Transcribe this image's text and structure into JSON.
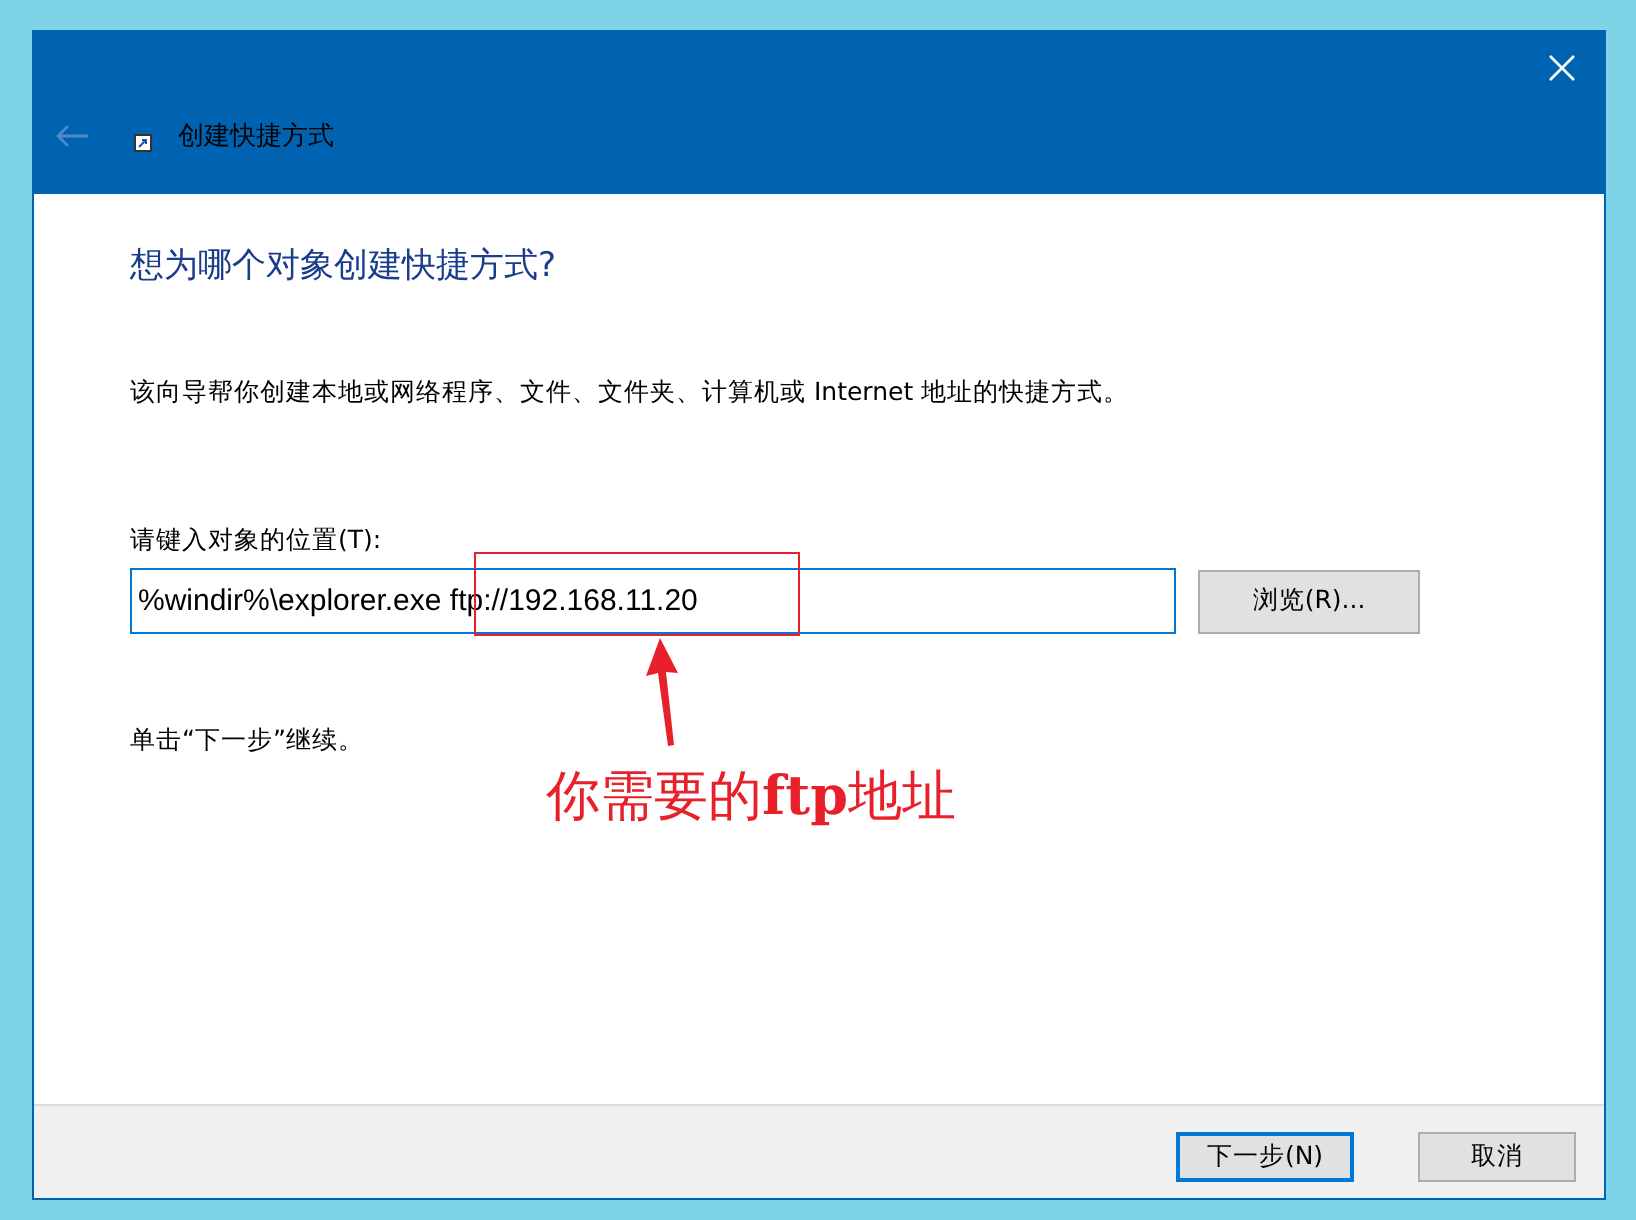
{
  "window": {
    "title": "创建快捷方式",
    "back_disabled": true
  },
  "heading": "想为哪个对象创建快捷方式?",
  "description": "该向导帮你创建本地或网络程序、文件、文件夹、计算机或 Internet 地址的快捷方式。",
  "location_label": "请键入对象的位置(T):",
  "location_field": {
    "value": "%windir%\\explorer.exe ftp://192.168.11.20"
  },
  "browse_button": "浏览(R)...",
  "hint": "单击“下一步”继续。",
  "annotation": {
    "text": "你需要的**ftp**地址"
  },
  "buttons": [
    {
      "label": "下一步(N)",
      "default": true
    },
    {
      "label": "取消",
      "default": false
    }
  ]
}
